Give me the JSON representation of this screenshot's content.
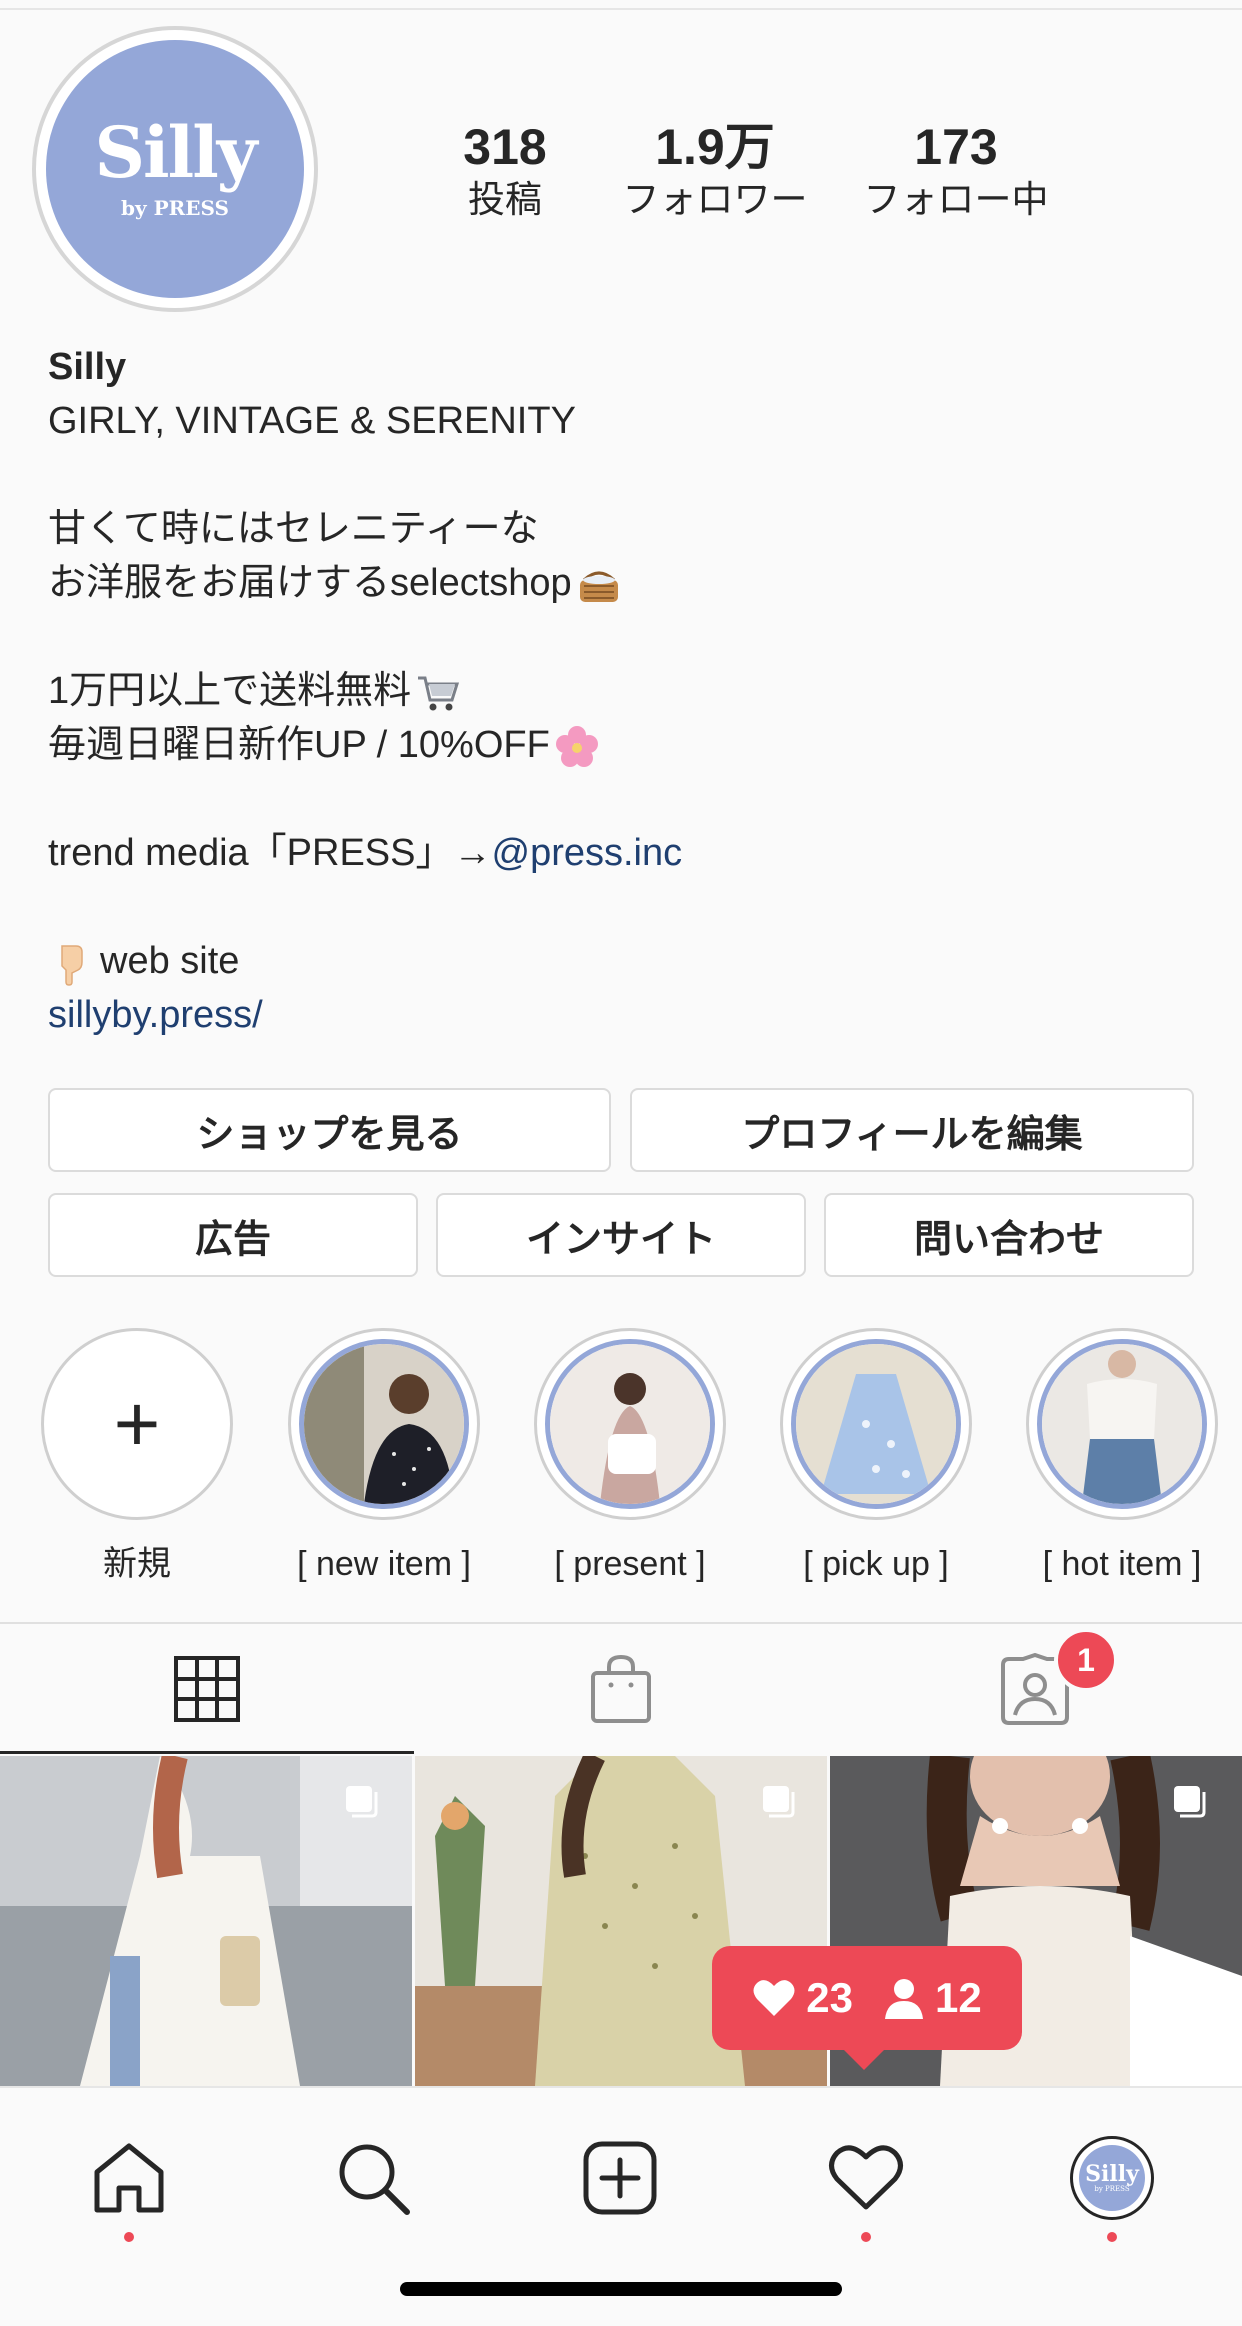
{
  "profile": {
    "avatar_text": "Silly",
    "avatar_sub": "by PRESS",
    "stats": [
      {
        "value": "318",
        "label": "投稿"
      },
      {
        "value": "1.9万",
        "label": "フォロワー"
      },
      {
        "value": "173",
        "label": "フォロー中"
      }
    ],
    "name": "Silly",
    "tagline": "GIRLY, VINTAGE & SERENITY",
    "bio_line1": "甘くて時にはセレニティーな",
    "bio_line2": "お洋服をお届けするselectshop",
    "bio_line3": "1万円以上で送料無料",
    "bio_line4": "毎週日曜日新作UP / 10%OFF",
    "bio_line5_prefix": "trend media「PRESS」→",
    "bio_line5_mention": "@press.inc",
    "bio_line6": "web site",
    "website": "sillyby.press/"
  },
  "buttons": {
    "shop": "ショップを見る",
    "edit_profile": "プロフィールを編集",
    "ads": "広告",
    "insights": "インサイト",
    "contact": "問い合わせ"
  },
  "highlights": {
    "new_label": "新規",
    "items": [
      {
        "label": "[ new item ]"
      },
      {
        "label": "[ present ]"
      },
      {
        "label": "[ pick up ]"
      },
      {
        "label": "[ hot item ]"
      }
    ]
  },
  "tabs": {
    "tagged_badge": "1"
  },
  "activity": {
    "likes": "23",
    "followers": "12"
  },
  "colors": {
    "accent": "#ed4956",
    "avatar_bg": "#94a7d8",
    "link": "#1f3f70"
  },
  "icons": {
    "grid": "grid-icon",
    "shop": "shopping-bag-icon",
    "tagged": "tagged-person-icon",
    "home": "home-icon",
    "search": "search-icon",
    "add": "add-post-icon",
    "heart": "heart-icon"
  }
}
